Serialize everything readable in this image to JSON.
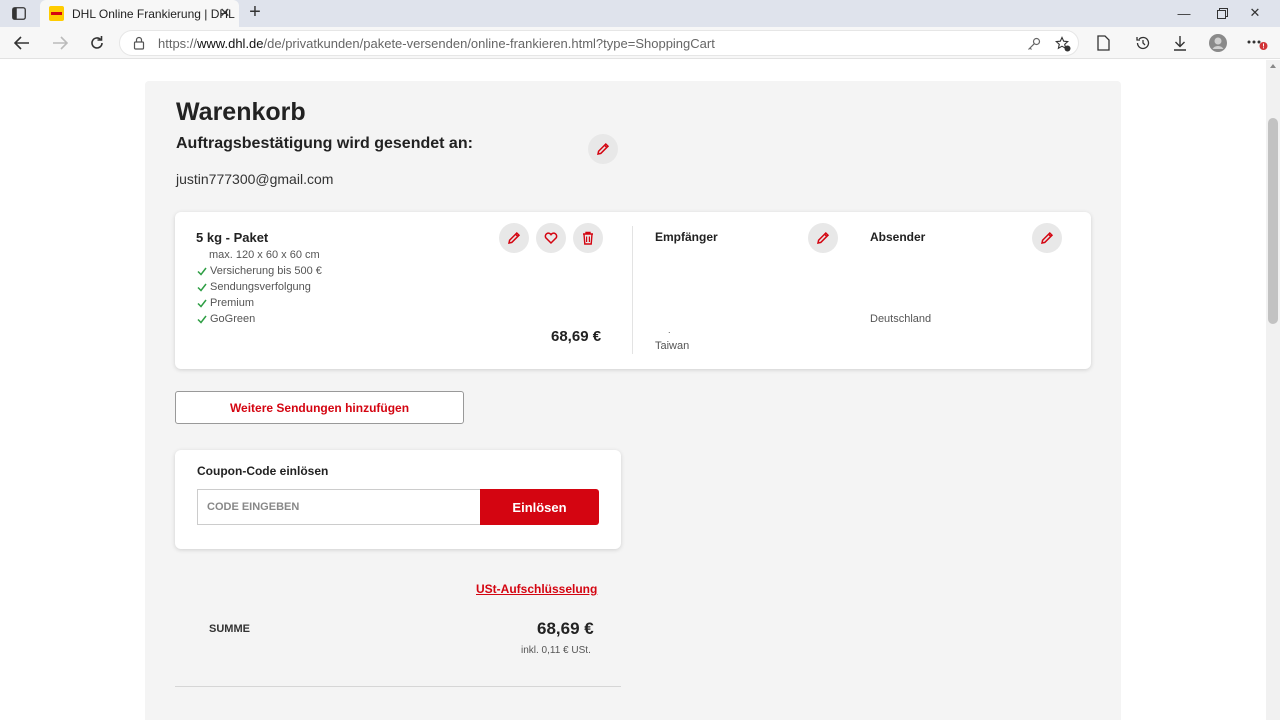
{
  "browser": {
    "tab_title": "DHL Online Frankierung | DHL",
    "url_prefix": "https://",
    "url_host": "www.dhl.de",
    "url_path": "/de/privatkunden/pakete-versenden/online-frankieren.html?type=ShoppingCart"
  },
  "page": {
    "title": "Warenkorb",
    "confirmation_label": "Auftragsbestätigung wird gesendet an:",
    "email": "justin777300@gmail.com"
  },
  "shipment": {
    "product": "5 kg - Paket",
    "dimensions": "max. 120 x 60 x 60 cm",
    "features": [
      "Versicherung bis 500 €",
      "Sendungsverfolgung",
      "Premium",
      "GoGreen"
    ],
    "price": "68,69 €",
    "recipient_title": "Empfänger",
    "recipient_mark": ".",
    "recipient_country": "Taiwan",
    "sender_title": "Absender",
    "sender_country": "Deutschland"
  },
  "actions": {
    "add_more": "Weitere Sendungen hinzufügen"
  },
  "coupon": {
    "title": "Coupon-Code einlösen",
    "placeholder": "CODE EINGEBEN",
    "redeem": "Einlösen"
  },
  "summary": {
    "vat_link": "USt-Aufschlüsselung",
    "sum_label": "SUMME",
    "sum_value": "68,69 €",
    "vat_note": "inkl. 0,11 € USt."
  },
  "colors": {
    "dhl_red": "#d40511",
    "dhl_yellow": "#ffcc00",
    "check_green": "#2e9e44"
  }
}
